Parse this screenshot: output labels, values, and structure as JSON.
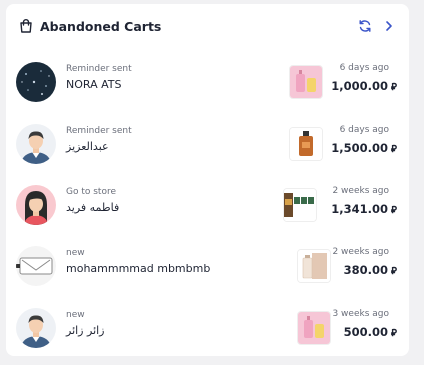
{
  "header": {
    "title": "Abandoned Carts",
    "title_icon": "shopping-bag-icon",
    "refresh_icon": "refresh-icon",
    "next_icon": "chevron-right-icon"
  },
  "currency_symbol": "⃁",
  "carts": [
    {
      "status": "Reminder sent",
      "name": "NORA ATS",
      "time": "6 days ago",
      "amount": "1,000.00",
      "avatar": "dark-photo-avatar",
      "thumb": "pink-product-thumb"
    },
    {
      "status": "Reminder sent",
      "name": "عبدالعزيز",
      "time": "6 days ago",
      "amount": "1,500.00",
      "avatar": "male-avatar",
      "thumb": "perfume-bottle-thumb"
    },
    {
      "status": "Go to store",
      "name": "فاطمه فريد",
      "time": "2 weeks ago",
      "amount": "1,341.00",
      "avatar": "female-avatar",
      "thumb": "multi-product-thumb"
    },
    {
      "status": "new",
      "name": "mohammmmad mbmbmb",
      "time": "2 weeks ago",
      "amount": "380.00",
      "avatar": "device-avatar",
      "thumb": "beige-product-thumb"
    },
    {
      "status": "new",
      "name": "زائر زائر",
      "time": "3 weeks ago",
      "amount": "500.00",
      "avatar": "male-avatar",
      "thumb": "pink-product-thumb"
    }
  ]
}
